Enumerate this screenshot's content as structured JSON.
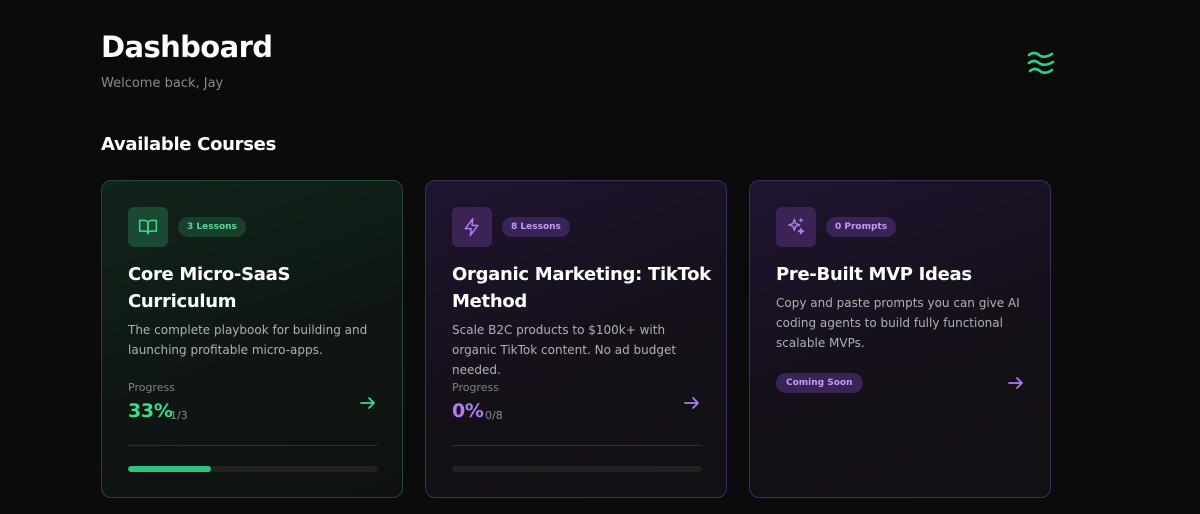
{
  "header": {
    "title": "Dashboard",
    "subtitle": "Welcome back, Jay",
    "logo_icon": "waves-logo-icon"
  },
  "section": {
    "title": "Available Courses"
  },
  "colors": {
    "green": "#3ddc8f",
    "purple": "#b07ef0",
    "background": "#0b0b0b"
  },
  "courses": [
    {
      "icon": "book-open-icon",
      "badge": "3 Lessons",
      "title": "Core Micro-SaaS Curriculum",
      "description": "The complete playbook for building and launching profitable micro-apps.",
      "progress_label": "Progress",
      "progress_pct": "33%",
      "progress_count": "1/3",
      "progress_fraction": 0.33
    },
    {
      "icon": "zap-icon",
      "badge": "8 Lessons",
      "title": "Organic Marketing: TikTok Method",
      "description": "Scale B2C products to $100k+ with organic TikTok content. No ad budget needed.",
      "progress_label": "Progress",
      "progress_pct": "0%",
      "progress_count": "0/8",
      "progress_fraction": 0
    },
    {
      "icon": "sparkles-icon",
      "badge": "0 Prompts",
      "title": "Pre-Built MVP Ideas",
      "description": "Copy and paste prompts you can give AI coding agents to build fully functional scalable MVPs.",
      "status": "Coming Soon"
    }
  ]
}
